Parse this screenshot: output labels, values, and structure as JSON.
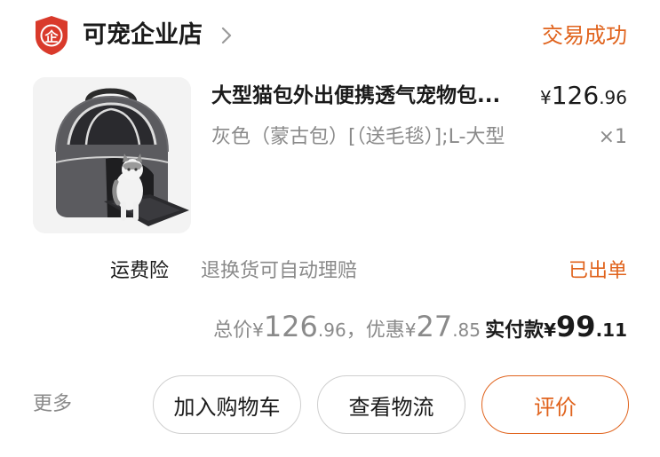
{
  "shop": {
    "logo_char": "企",
    "name": "可宠企业店",
    "chevron_icon": "chevron-right-icon"
  },
  "order": {
    "status": "交易成功"
  },
  "product": {
    "image_icon": "pet-carrier-bag-with-cat",
    "title": "大型猫包外出便携透气宠物包...",
    "price": {
      "currency": "¥",
      "integer": "126",
      "decimal": ".96"
    },
    "sku": "灰色（蒙古包）[（送毛毯）];L-大型",
    "quantity": "×1"
  },
  "service": {
    "name": "运费险",
    "description": "退换货可自动理赔",
    "shipping_status": "已出单"
  },
  "totals": {
    "total_label": "总价",
    "total_currency": "¥",
    "total_integer": "126",
    "total_decimal": ".96",
    "separator": "，",
    "discount_label": "优惠",
    "discount_currency": "¥",
    "discount_integer": "27",
    "discount_decimal": ".85",
    "paid_label": "实付款",
    "paid_currency": "¥",
    "paid_integer": "99",
    "paid_decimal": ".11"
  },
  "actions": {
    "more": "更多",
    "add_to_cart": "加入购物车",
    "view_logistics": "查看物流",
    "review": "评价"
  },
  "colors": {
    "accent": "#e0631d",
    "logo_red": "#d93a2b",
    "text": "#1a1a1a",
    "muted": "#8a8a8a"
  }
}
